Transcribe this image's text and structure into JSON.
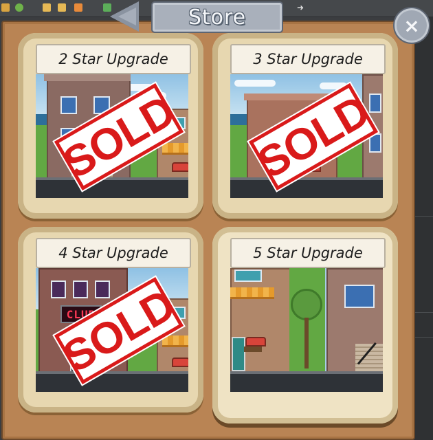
{
  "window": {
    "title": "Store",
    "close_glyph": "×",
    "back_icon": "back-arrow-icon"
  },
  "items": [
    {
      "label": "2 Star Upgrade",
      "status": "SOLD"
    },
    {
      "label": "3 Star Upgrade",
      "status": "SOLD"
    },
    {
      "label": "4 Star Upgrade",
      "status": "SOLD",
      "scene_sign": "CLUB"
    },
    {
      "label": "5 Star Upgrade",
      "status": ""
    }
  ],
  "colors": {
    "frame": "#b98454",
    "card": "#e7d7b0",
    "sold": "#d91a1a",
    "title_tab": "#a9b0bb"
  }
}
